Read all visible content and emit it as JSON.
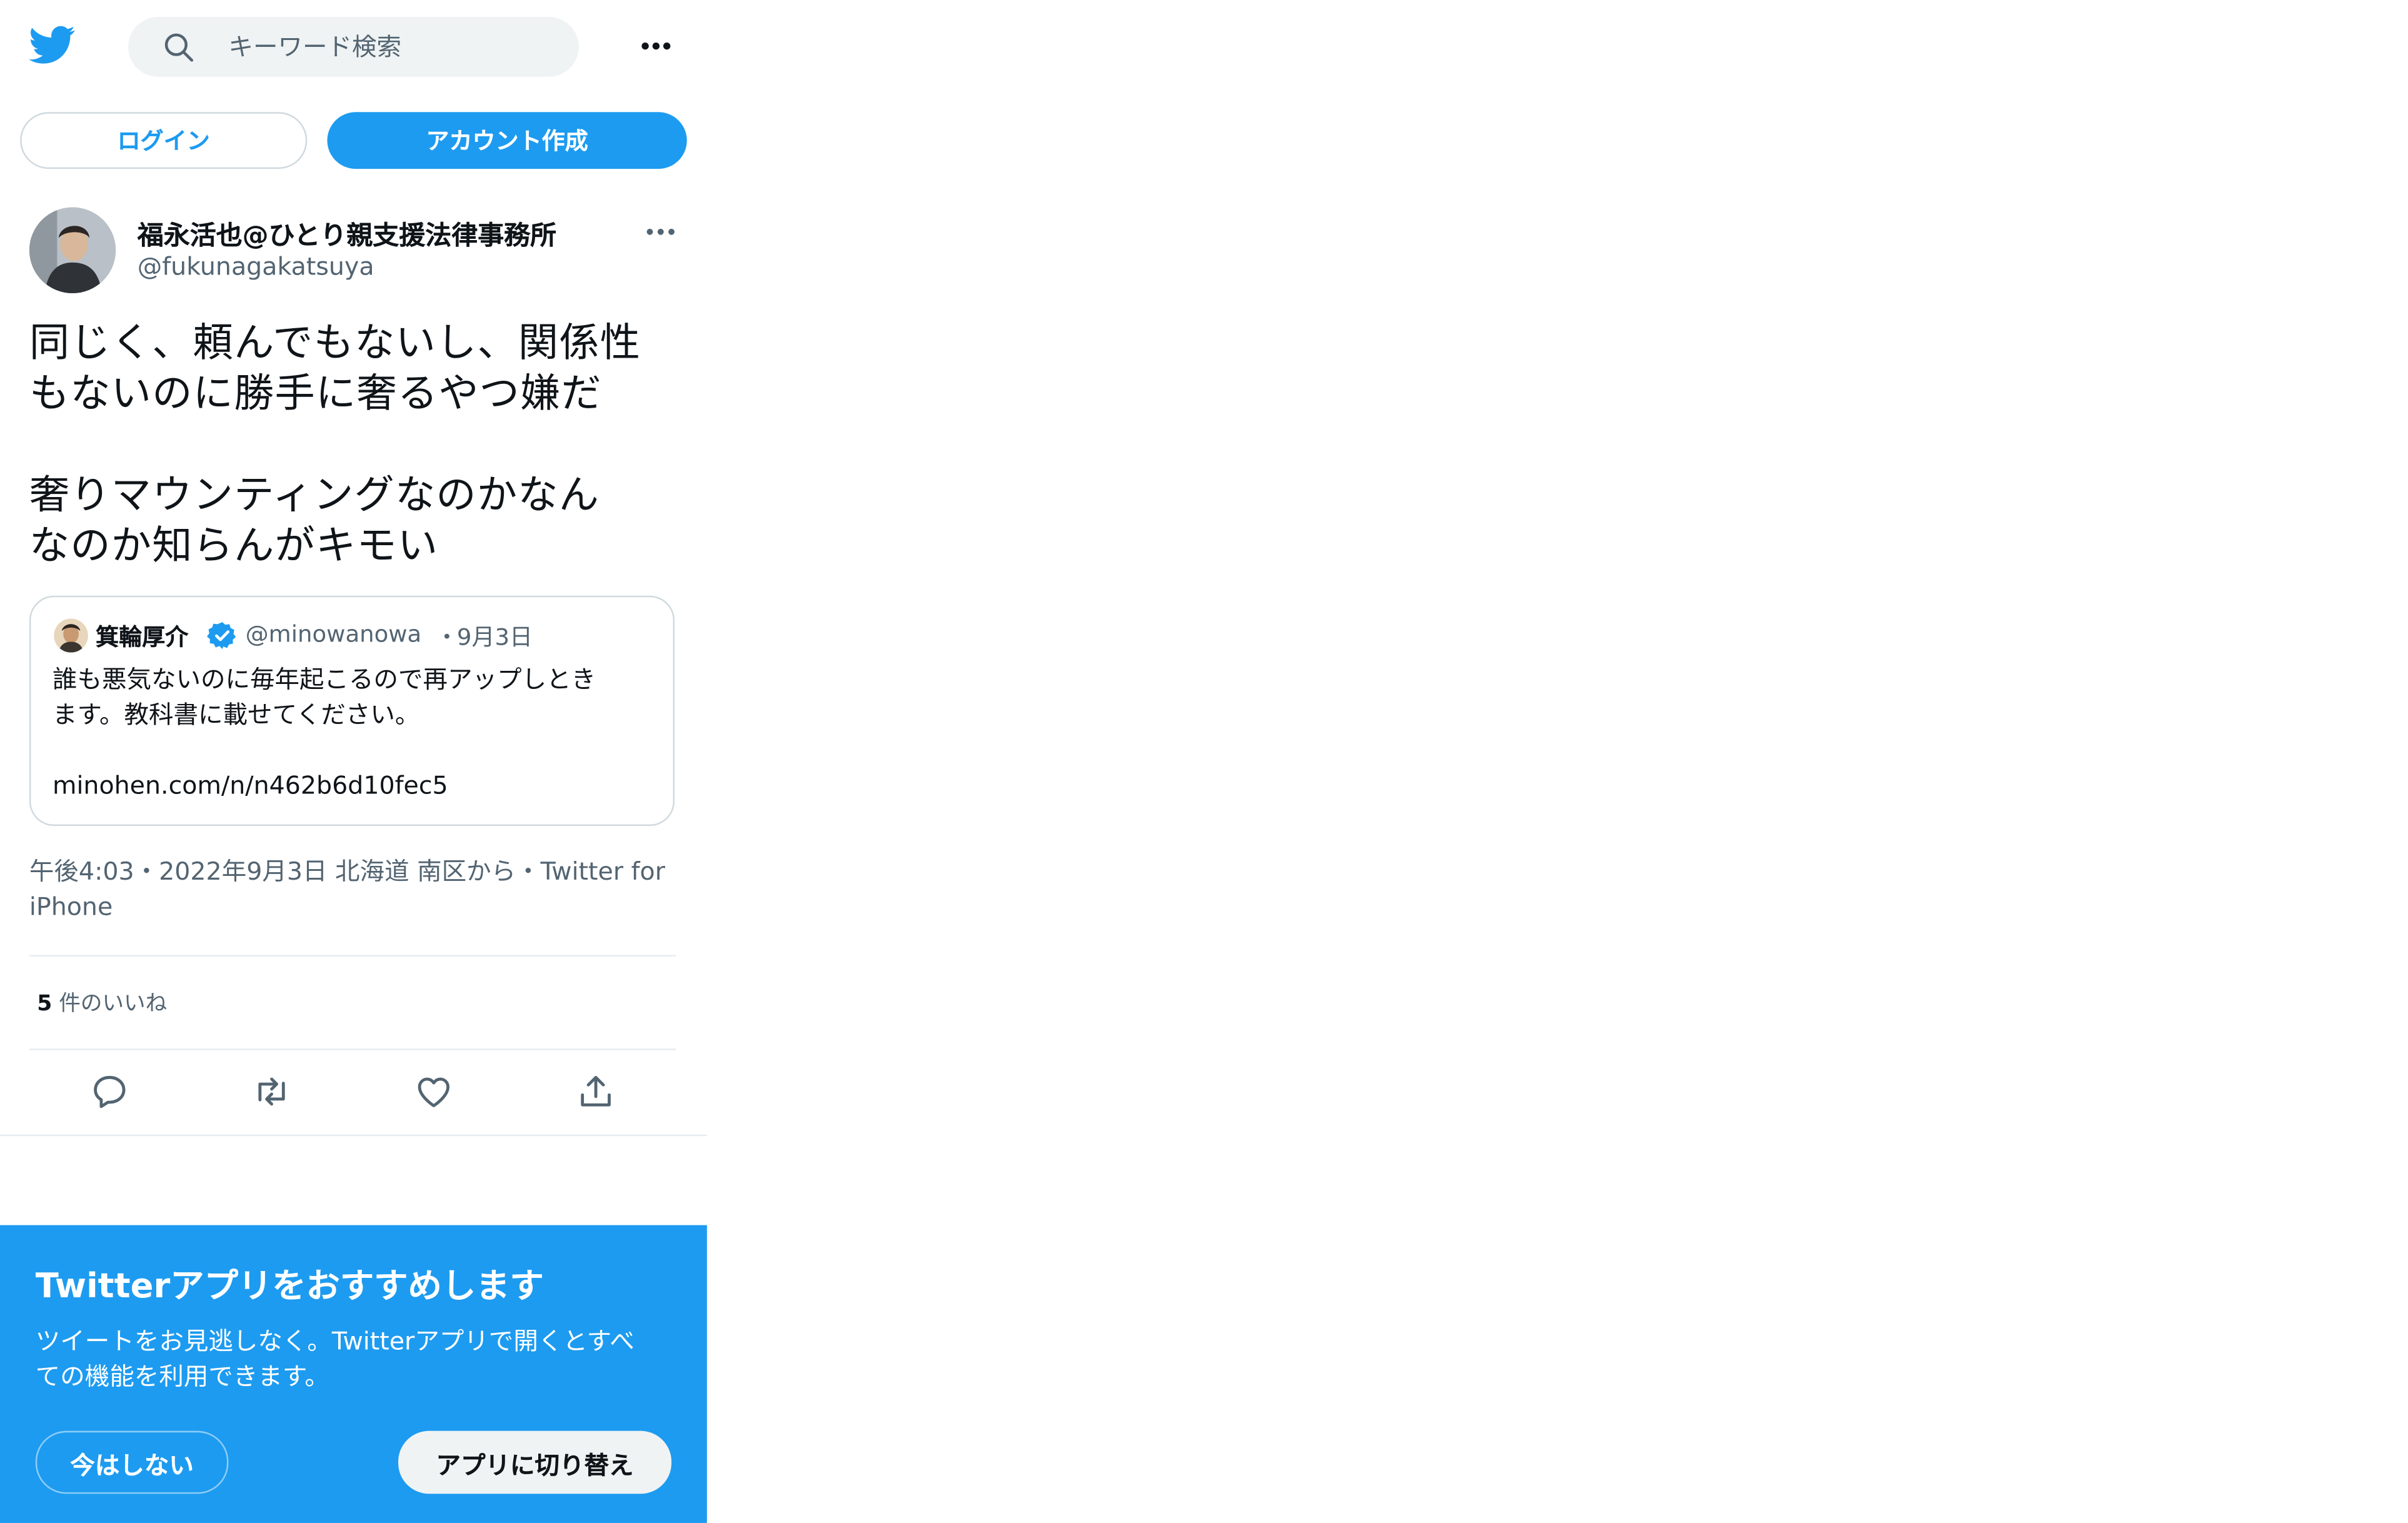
{
  "header": {
    "logo_icon": "twitter-bird-icon",
    "search_placeholder": "キーワード検索",
    "more_icon": "more-horizontal-icon"
  },
  "auth": {
    "login_label": "ログイン",
    "signup_label": "アカウント作成"
  },
  "tweet": {
    "author_name": "福永活也@ひとり親支援法律事務所",
    "author_handle": "@fukunagakatsuya",
    "text": "同じく、頼んでもないし、関係性\nもないのに勝手に奢るやつ嫌だ\n\n奢りマウンティングなのかなん\nなのか知らんがキモい",
    "timestamp_line": "午後4:03・2022年9月3日 北海道 南区から・Twitter for iPhone",
    "likes_count": "5",
    "likes_label": "件のいいね"
  },
  "quote": {
    "author_name": "箕輪厚介",
    "author_handle": "@minowanowa",
    "separator": "・",
    "date": "9月3日",
    "text": "誰も悪気ないのに毎年起こるので再アップしとき\nます。教科書に載せてください。\n\nminohen.com/n/n462b6d10fec5"
  },
  "actions": [
    "reply-icon",
    "retweet-icon",
    "like-icon",
    "share-icon"
  ],
  "banner": {
    "title": "Twitterアプリをおすすめします",
    "text": "ツイートをお見逃しなく。Twitterアプリで開くとすべ\nての機能を利用できます。",
    "dismiss_label": "今はしない",
    "switch_label": "アプリに切り替え"
  },
  "colors": {
    "brand": "#1d9bf0",
    "text": "#0f1419",
    "muted": "#536471",
    "border": "#cfd9de"
  }
}
